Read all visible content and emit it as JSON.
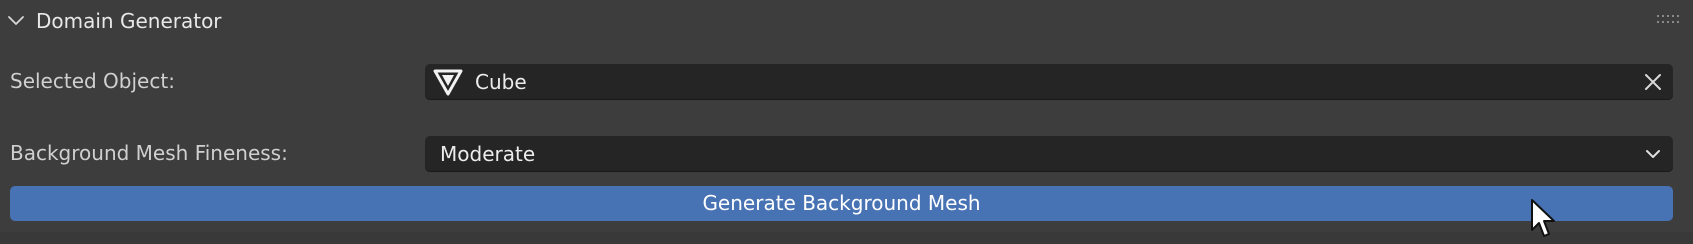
{
  "panel": {
    "title": "Domain Generator",
    "expanded": true
  },
  "selected_object": {
    "label": "Selected Object:",
    "value": "Cube",
    "icon": "mesh-icon"
  },
  "fineness": {
    "label": "Background Mesh Fineness:",
    "value": "Moderate"
  },
  "generate_button": {
    "label": "Generate Background Mesh"
  },
  "colors": {
    "panel_bg": "#3d3d3d",
    "field_bg": "#252525",
    "button_accent": "#4772b3"
  }
}
